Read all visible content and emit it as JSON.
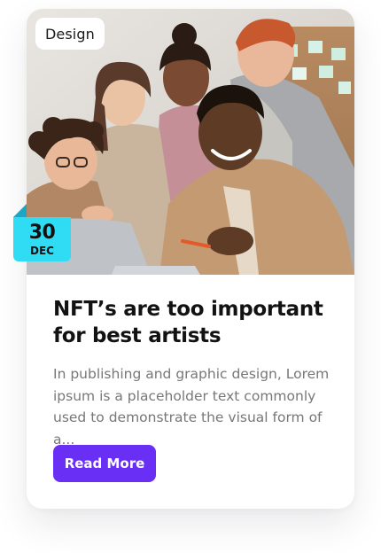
{
  "card": {
    "category": "Design",
    "date": {
      "day": "30",
      "month": "DEC"
    },
    "title": "NFT’s are too important for best artists",
    "excerpt": "In publishing and graphic design, Lorem ipsum is a placeholder text commonly used to demonstrate the visual form of a...",
    "cta_label": "Read More"
  },
  "colors": {
    "accent": "#6a2ff5",
    "date_badge": "#2fdcf3",
    "title": "#121212",
    "body_text": "#777777"
  },
  "icons": {
    "image": "team-photo"
  }
}
